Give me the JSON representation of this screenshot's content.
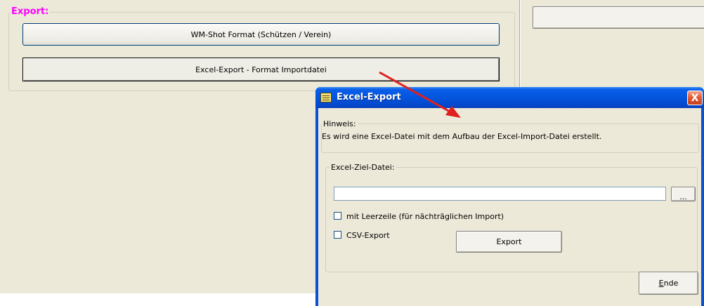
{
  "export_group": {
    "legend": "Export:",
    "wm_shot_button": "WM-Shot Format (Schützen / Verein)",
    "excel_export_button": "Excel-Export - Format Importdatei"
  },
  "dialog": {
    "title": "Excel-Export",
    "close_symbol": "X",
    "hint": {
      "legend": "Hinweis:",
      "text": "Es wird eine Excel-Datei mit dem Aufbau der Excel-Import-Datei erstellt."
    },
    "target": {
      "legend": "Excel-Ziel-Datei:",
      "file_path": "",
      "browse_label": "...",
      "checkbox_blank_line": {
        "label": "mit Leerzeile (für nächträglichen Import)",
        "checked": false
      },
      "checkbox_csv": {
        "label": "CSV-Export",
        "checked": false
      },
      "export_button": "Export"
    },
    "end_button_accel": "E",
    "end_button_rest": "nde"
  },
  "colors": {
    "legend_accent": "#ff00ff",
    "arrow": "#e02020",
    "titlebar": "#0355de",
    "panel": "#ece9d8"
  },
  "icons": {
    "title": "list-window-icon",
    "annotation": "red-arrow"
  }
}
